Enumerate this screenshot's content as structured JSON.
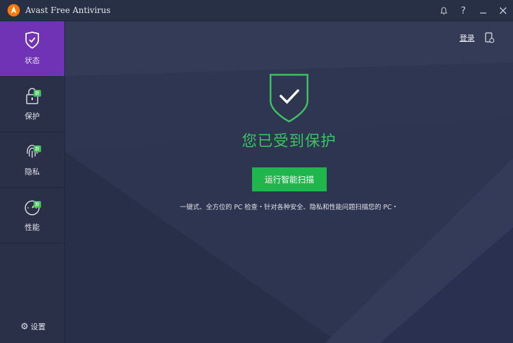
{
  "window": {
    "title": "Avast Free Antivirus"
  },
  "sidebar": {
    "items": [
      {
        "label": "状态",
        "icon": "shield-check-icon",
        "active": true
      },
      {
        "label": "保护",
        "icon": "lock-icon",
        "badge": "新"
      },
      {
        "label": "隐私",
        "icon": "fingerprint-icon",
        "badge": "新"
      },
      {
        "label": "性能",
        "icon": "speedometer-icon",
        "badge": "新"
      }
    ],
    "settings_label": "设置"
  },
  "header": {
    "login_label": "登录"
  },
  "main": {
    "status_text": "您已受到保护",
    "scan_button_label": "运行智能扫描",
    "description": "一键式、全方位的 PC 检查・针对各种安全、隐私和性能问题扫描您的 PC・"
  },
  "colors": {
    "accent_purple": "#7133b6",
    "accent_green": "#1fb64e",
    "status_green": "#3fc262",
    "background": "#2b3148",
    "logo_orange": "#ff7800"
  }
}
